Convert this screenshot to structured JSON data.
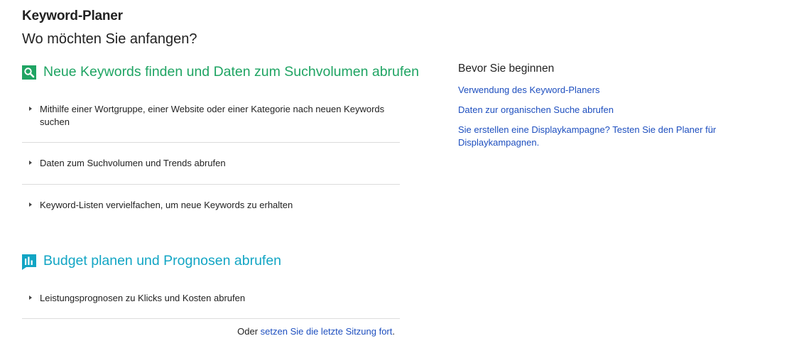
{
  "page": {
    "title": "Keyword-Planer",
    "subtitle": "Wo möchten Sie anfangen?"
  },
  "colors": {
    "find_keywords_accent": "#1fa463",
    "budget_accent": "#12a5c4",
    "link": "#1e4fbf"
  },
  "find_keywords": {
    "icon": "magnifier-icon",
    "heading": "Neue Keywords finden und Daten zum Suchvolumen abrufen",
    "options": [
      "Mithilfe einer Wortgruppe, einer Website oder einer Kategorie nach neuen Keywords suchen",
      "Daten zum Suchvolumen und Trends abrufen",
      "Keyword-Listen vervielfachen, um neue Keywords zu erhalten"
    ]
  },
  "budget": {
    "icon": "bar-chart-icon",
    "heading": "Budget planen und Prognosen abrufen",
    "options": [
      "Leistungsprognosen zu Klicks und Kosten abrufen"
    ]
  },
  "footer": {
    "prefix": "Oder ",
    "link": "setzen Sie die letzte Sitzung fort",
    "suffix": "."
  },
  "before_you_start": {
    "title": "Bevor Sie beginnen",
    "links": [
      "Verwendung des Keyword-Planers",
      "Daten zur organischen Suche abrufen",
      "Sie erstellen eine Displaykampagne? Testen Sie den Planer für Displaykampagnen."
    ]
  }
}
